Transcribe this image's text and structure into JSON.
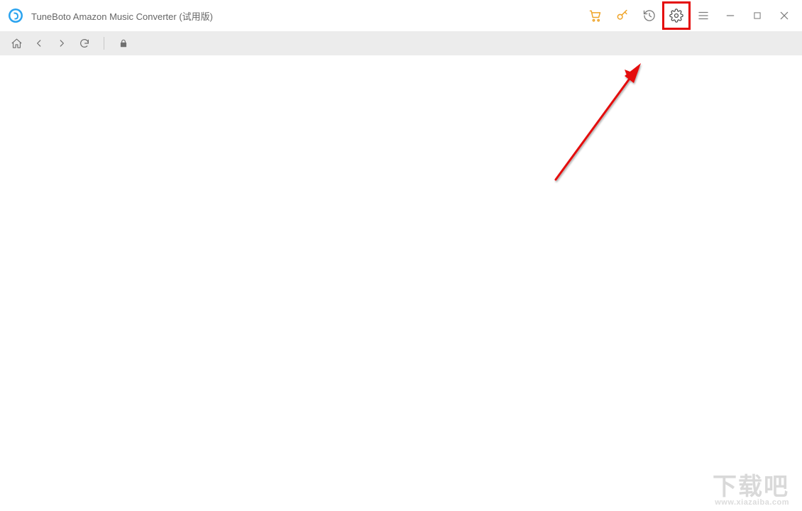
{
  "titlebar": {
    "app_title": "TuneBoto Amazon Music Converter (试用版)",
    "icons": {
      "logo": "app-logo",
      "cart": "cart-icon",
      "key": "key-icon",
      "history": "history-icon",
      "settings": "settings-icon",
      "menu": "menu-icon",
      "minimize": "minimize-icon",
      "maximize": "maximize-icon",
      "close": "close-icon"
    }
  },
  "navbar": {
    "icons": {
      "home": "home-icon",
      "back": "back-icon",
      "forward": "forward-icon",
      "reload": "reload-icon",
      "lock": "lock-icon"
    }
  },
  "annotation": {
    "highlight_target": "settings-button"
  },
  "watermark": {
    "big": "下载吧",
    "small": "www.xiazaiba.com"
  }
}
